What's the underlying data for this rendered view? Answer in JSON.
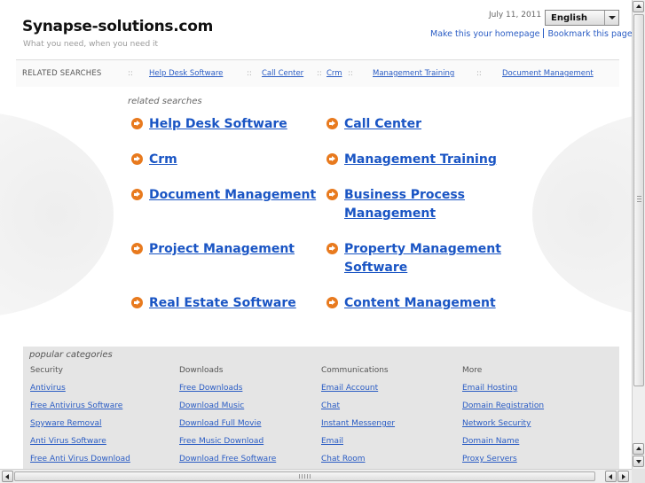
{
  "header": {
    "title": "Synapse-solutions.com",
    "tagline": "What you need, when you need it",
    "date": "July 11, 2011",
    "language": "English",
    "homepage_link": "Make this your homepage",
    "bookmark_link": "Bookmark this page"
  },
  "related_bar": {
    "title": "RELATED SEARCHES",
    "separator": "::",
    "links": [
      "Help Desk Software",
      "Call Center",
      "Crm",
      "Management Training",
      "Document Management"
    ]
  },
  "related": {
    "title": "related searches",
    "left": [
      {
        "line1": "Help Desk Software",
        "line2": ""
      },
      {
        "line1": "Crm",
        "line2": ""
      },
      {
        "line1": "Document Management",
        "line2": ""
      },
      {
        "line1": "Project Management",
        "line2": ""
      },
      {
        "line1": "Real Estate Software",
        "line2": ""
      }
    ],
    "right": [
      {
        "line1": "Call Center",
        "line2": ""
      },
      {
        "line1": "Management Training",
        "line2": ""
      },
      {
        "line1": "Business Process",
        "line2": "Management"
      },
      {
        "line1": "Property Management",
        "line2": "Software"
      },
      {
        "line1": "Content Management",
        "line2": ""
      }
    ]
  },
  "popular": {
    "title": "popular categories",
    "columns": [
      {
        "header": "Security",
        "links": [
          "Antivirus",
          "Free Antivirus Software",
          "Spyware Removal",
          "Anti Virus Software",
          "Free Anti Virus Download"
        ]
      },
      {
        "header": "Downloads",
        "links": [
          "Free Downloads",
          "Download Music",
          "Download Full Movie",
          "Free Music Download",
          "Download Free Software"
        ]
      },
      {
        "header": "Communications",
        "links": [
          "Email Account",
          "Chat",
          "Instant Messenger",
          "Email",
          "Chat Room"
        ]
      },
      {
        "header": "More",
        "links": [
          "Email Hosting",
          "Domain Registration",
          "Network Security",
          "Domain Name",
          "Proxy Servers"
        ]
      }
    ]
  },
  "colors": {
    "link": "#1a55c4",
    "arrow": "#e87a1e",
    "popular_bg": "#e5e5e5"
  }
}
